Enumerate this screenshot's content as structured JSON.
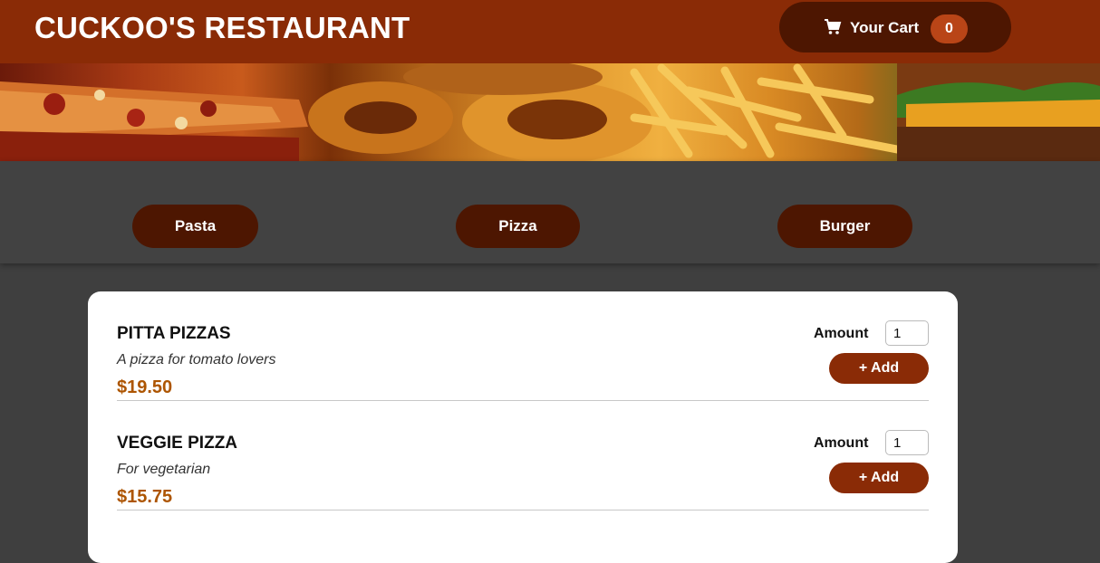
{
  "header": {
    "brand": "CUCKOO'S RESTAURANT",
    "cart": {
      "label": "Your Cart",
      "count": "0",
      "icon": "cart-icon"
    }
  },
  "hero": {
    "image": "food banner: pizza, onion rings, fries, burger"
  },
  "categories": [
    {
      "label": "Pasta"
    },
    {
      "label": "Pizza"
    },
    {
      "label": "Burger"
    }
  ],
  "meals": [
    {
      "name": "PITTA PIZZAS",
      "description": "A pizza for tomato lovers",
      "price": "$19.50",
      "amount_label": "Amount",
      "amount_value": "1",
      "add_label": "+ Add"
    },
    {
      "name": "VEGGIE PIZZA",
      "description": "For vegetarian",
      "price": "$15.75",
      "amount_label": "Amount",
      "amount_value": "1",
      "add_label": "+ Add"
    }
  ],
  "colors": {
    "header": "#8a2b06",
    "dark_button": "#4d1601",
    "badge": "#b94517",
    "price": "#ad5502",
    "background": "#3f3f3f"
  }
}
